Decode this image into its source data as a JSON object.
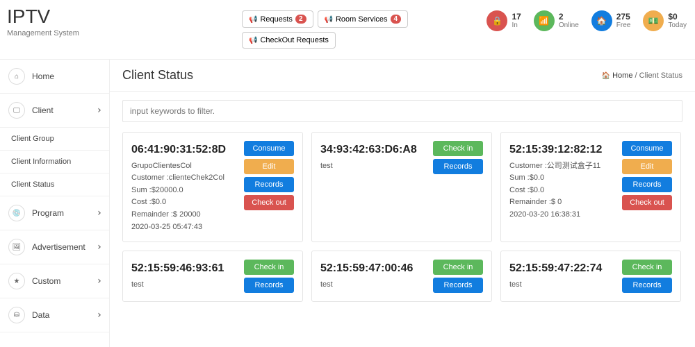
{
  "brand": {
    "title": "IPTV",
    "subtitle": "Management System"
  },
  "topbtns": {
    "requests": {
      "label": "Requests",
      "badge": "2"
    },
    "room": {
      "label": "Room Services",
      "badge": "4"
    },
    "checkout": {
      "label": "CheckOut Requests"
    }
  },
  "stats": {
    "in": {
      "num": "17",
      "lbl": "In"
    },
    "online": {
      "num": "2",
      "lbl": "Online"
    },
    "free": {
      "num": "275",
      "lbl": "Free"
    },
    "today": {
      "num": "$0",
      "lbl": "Today"
    }
  },
  "sidebar": {
    "home": "Home",
    "client": "Client",
    "client_group": "Client Group",
    "client_info": "Client Information",
    "client_status": "Client Status",
    "program": "Program",
    "advert": "Advertisement",
    "custom": "Custom",
    "data": "Data"
  },
  "page": {
    "title": "Client Status"
  },
  "breadcrumb": {
    "home": "Home",
    "sep": " / ",
    "current": "Client Status"
  },
  "filter": {
    "placeholder": "input keywords to filter."
  },
  "btns": {
    "consume": "Consume",
    "edit": "Edit",
    "records": "Records",
    "checkout": "Check out",
    "checkin": "Check in"
  },
  "cards": [
    {
      "mac": "06:41:90:31:52:8D",
      "lines": [
        "GrupoClientesCol",
        "Customer :clienteChek2Col",
        "Sum :$20000.0",
        "Cost :$0.0",
        "Remainder :$ 20000",
        "2020-03-25 05:47:43"
      ],
      "mode": "full"
    },
    {
      "mac": "34:93:42:63:D6:A8",
      "lines": [
        "test"
      ],
      "mode": "simple"
    },
    {
      "mac": "52:15:39:12:82:12",
      "lines": [
        "Customer :公司测试盒子11",
        "Sum :$0.0",
        "Cost :$0.0",
        "Remainder :$ 0",
        "2020-03-20 16:38:31"
      ],
      "mode": "full"
    },
    {
      "mac": "52:15:59:46:93:61",
      "lines": [
        "test"
      ],
      "mode": "simple"
    },
    {
      "mac": "52:15:59:47:00:46",
      "lines": [
        "test"
      ],
      "mode": "simple"
    },
    {
      "mac": "52:15:59:47:22:74",
      "lines": [
        "test"
      ],
      "mode": "simple"
    }
  ]
}
